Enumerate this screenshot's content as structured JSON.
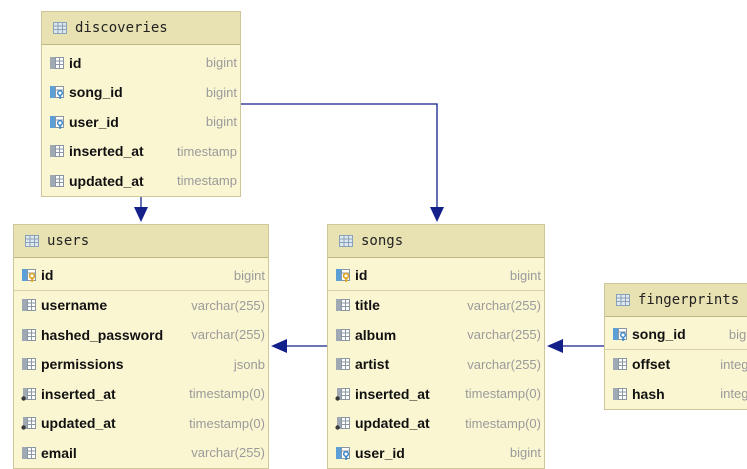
{
  "tables": [
    {
      "id": "discoveries",
      "name": "discoveries",
      "columns": [
        {
          "name": "id",
          "type": "bigint",
          "icon": "column-icon"
        },
        {
          "name": "song_id",
          "type": "bigint",
          "icon": "foreign-key-icon"
        },
        {
          "name": "user_id",
          "type": "bigint",
          "icon": "foreign-key-icon"
        },
        {
          "name": "inserted_at",
          "type": "timestamp",
          "icon": "column-icon"
        },
        {
          "name": "updated_at",
          "type": "timestamp",
          "icon": "column-icon"
        }
      ]
    },
    {
      "id": "users",
      "name": "users",
      "columns": [
        {
          "name": "id",
          "type": "bigint",
          "icon": "primary-key-icon"
        },
        {
          "name": "username",
          "type": "varchar(255)",
          "icon": "column-icon"
        },
        {
          "name": "hashed_password",
          "type": "varchar(255)",
          "icon": "column-icon"
        },
        {
          "name": "permissions",
          "type": "jsonb",
          "icon": "column-icon"
        },
        {
          "name": "inserted_at",
          "type": "timestamp(0)",
          "icon": "not-null-column-icon"
        },
        {
          "name": "updated_at",
          "type": "timestamp(0)",
          "icon": "not-null-column-icon"
        },
        {
          "name": "email",
          "type": "varchar(255)",
          "icon": "column-icon"
        }
      ]
    },
    {
      "id": "songs",
      "name": "songs",
      "columns": [
        {
          "name": "id",
          "type": "bigint",
          "icon": "primary-key-icon"
        },
        {
          "name": "title",
          "type": "varchar(255)",
          "icon": "column-icon"
        },
        {
          "name": "album",
          "type": "varchar(255)",
          "icon": "column-icon"
        },
        {
          "name": "artist",
          "type": "varchar(255)",
          "icon": "column-icon"
        },
        {
          "name": "inserted_at",
          "type": "timestamp(0)",
          "icon": "not-null-column-icon"
        },
        {
          "name": "updated_at",
          "type": "timestamp(0)",
          "icon": "not-null-column-icon"
        },
        {
          "name": "user_id",
          "type": "bigint",
          "icon": "foreign-key-icon"
        }
      ]
    },
    {
      "id": "fingerprints",
      "name": "fingerprints",
      "columns": [
        {
          "name": "song_id",
          "type": "bigint",
          "icon": "foreign-key-icon"
        },
        {
          "name": "offset",
          "type": "integer",
          "icon": "column-icon"
        },
        {
          "name": "hash",
          "type": "integer",
          "icon": "column-icon"
        }
      ]
    }
  ],
  "relations": [
    {
      "from": "discoveries",
      "to": "users"
    },
    {
      "from": "discoveries",
      "to": "songs"
    },
    {
      "from": "songs",
      "to": "users"
    },
    {
      "from": "fingerprints",
      "to": "songs"
    }
  ],
  "colors": {
    "edge": "#14208a",
    "table_body": "#fbf6d2",
    "table_header": "#e8e2b3"
  }
}
